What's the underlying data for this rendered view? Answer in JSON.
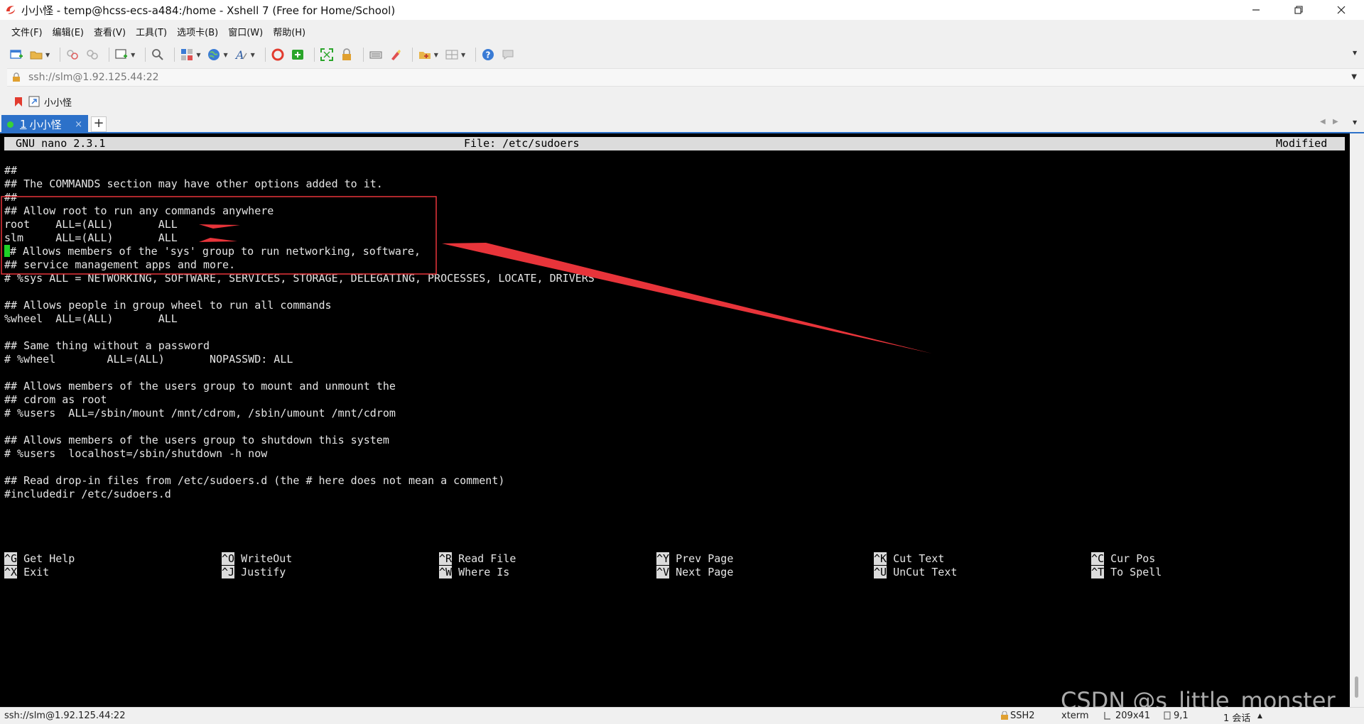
{
  "window": {
    "title": "小小怪 - temp@hcss-ecs-a484:/home - Xshell 7 (Free for Home/School)"
  },
  "menu": [
    "文件(F)",
    "编辑(E)",
    "查看(V)",
    "工具(T)",
    "选项卡(B)",
    "窗口(W)",
    "帮助(H)"
  ],
  "address": {
    "value": "ssh://slm@1.92.125.44:22"
  },
  "session_bar": {
    "label": "小小怪"
  },
  "tabs": [
    {
      "number": "1",
      "label": "小小怪",
      "close": "×"
    }
  ],
  "tab_add": "+",
  "nano": {
    "version": "GNU nano 2.3.1",
    "file": "File: /etc/sudoers",
    "status": "Modified"
  },
  "lines": [
    "",
    "##",
    "## The COMMANDS section may have other options added to it.",
    "##",
    "## Allow root to run any commands anywhere",
    "root    ALL=(ALL)       ALL",
    "slm     ALL=(ALL)       ALL",
    "# Allows members of the 'sys' group to run networking, software,",
    "## service management apps and more.",
    "# %sys ALL = NETWORKING, SOFTWARE, SERVICES, STORAGE, DELEGATING, PROCESSES, LOCATE, DRIVERS",
    "",
    "## Allows people in group wheel to run all commands",
    "%wheel  ALL=(ALL)       ALL",
    "",
    "## Same thing without a password",
    "# %wheel        ALL=(ALL)       NOPASSWD: ALL",
    "",
    "## Allows members of the users group to mount and unmount the",
    "## cdrom as root",
    "# %users  ALL=/sbin/mount /mnt/cdrom, /sbin/umount /mnt/cdrom",
    "",
    "## Allows members of the users group to shutdown this system",
    "# %users  localhost=/sbin/shutdown -h now",
    "",
    "## Read drop-in files from /etc/sudoers.d (the # here does not mean a comment)",
    "#includedir /etc/sudoers.d"
  ],
  "shortcuts": [
    [
      {
        "key": "^G",
        "label": "Get Help"
      },
      {
        "key": "^X",
        "label": "Exit"
      }
    ],
    [
      {
        "key": "^O",
        "label": "WriteOut"
      },
      {
        "key": "^J",
        "label": "Justify"
      }
    ],
    [
      {
        "key": "^R",
        "label": "Read File"
      },
      {
        "key": "^W",
        "label": "Where Is"
      }
    ],
    [
      {
        "key": "^Y",
        "label": "Prev Page"
      },
      {
        "key": "^V",
        "label": "Next Page"
      }
    ],
    [
      {
        "key": "^K",
        "label": "Cut Text"
      },
      {
        "key": "^U",
        "label": "UnCut Text"
      }
    ],
    [
      {
        "key": "^C",
        "label": "Cur Pos"
      },
      {
        "key": "^T",
        "label": "To Spell"
      }
    ]
  ],
  "watermark": "CSDN @s_little_monster_",
  "status": {
    "connection": "ssh://slm@1.92.125.44:22",
    "protocol": "SSH2",
    "terminal": "xterm",
    "size": "209x41",
    "position": "9,1",
    "sessions": "1 会话"
  },
  "colors": {
    "tab_active": "#2c71c9",
    "cursor": "#1fd126",
    "annotation_red": "#e8343a",
    "terminal_bg": "#000000"
  }
}
